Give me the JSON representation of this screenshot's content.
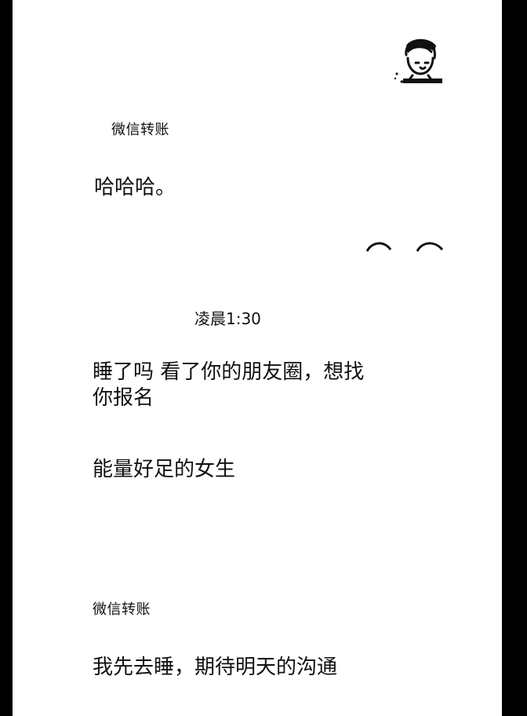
{
  "chat": {
    "transfer_label_1": "微信转账",
    "message_1": "哈哈哈。",
    "timestamp": "凌晨1:30",
    "message_2": "睡了吗 看了你的朋友圈，想找你报名",
    "message_3": "能量好足的女生",
    "transfer_label_2": "微信转账",
    "message_4": "我先去睡，期待明天的沟通"
  },
  "icons": {
    "avatar": "avatar-cartoon-portrait",
    "eyes": "peeking-eyes-emoji"
  },
  "colors": {
    "background": "#ffffff",
    "frame": "#000000",
    "text": "#111111"
  }
}
